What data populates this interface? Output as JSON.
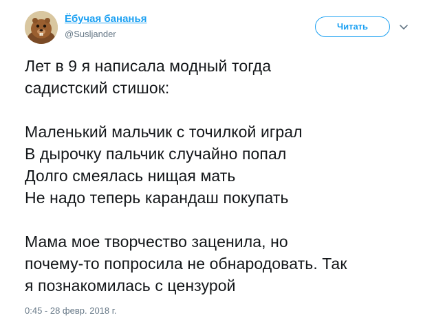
{
  "author": {
    "display_name": "Ёбучая бананья",
    "handle": "@Susljander",
    "avatar_icon": "beaver-avatar-icon"
  },
  "actions": {
    "follow_label": "Читать",
    "more_icon": "chevron-down-icon"
  },
  "tweet": {
    "lines": [
      "Лет в 9 я написала модный тогда",
      "садистский стишок:",
      "",
      "Маленький мальчик с точилкой играл",
      "В дырочку пальчик случайно попал",
      "Долго смеялась нищая мать",
      "Не надо теперь карандаш покупать",
      "",
      "Мама мое творчество заценила, но",
      "почему-то попросила не обнародовать. Так",
      "я познакомилась с цензурой"
    ],
    "timestamp": "0:45 - 28 февр. 2018 г."
  },
  "colors": {
    "accent": "#1da1f2",
    "text": "#14171a",
    "muted": "#657786"
  }
}
